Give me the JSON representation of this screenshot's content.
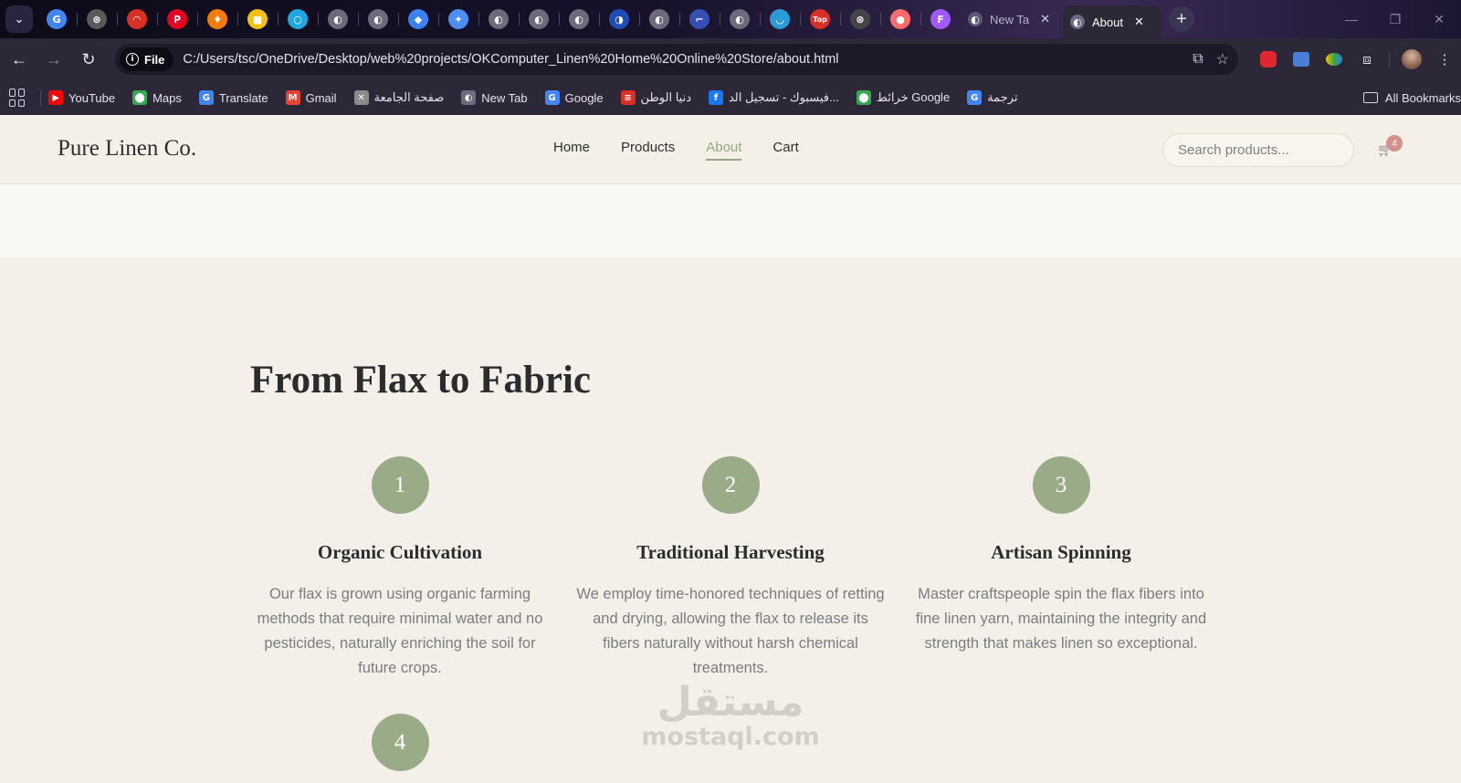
{
  "browser": {
    "pinned_tabs": [
      {
        "icon": "google-icon",
        "glyph": "G",
        "color": "#4285f4"
      },
      {
        "icon": "chatgpt-icon",
        "glyph": "⊛",
        "color": "#5a5a5a"
      },
      {
        "icon": "speed-icon",
        "glyph": "◠",
        "color": "#d93025"
      },
      {
        "icon": "pinterest-icon",
        "glyph": "P",
        "color": "#e60023"
      },
      {
        "icon": "flame-icon",
        "glyph": "♦",
        "color": "#f57c00"
      },
      {
        "icon": "folder-icon",
        "glyph": "■",
        "color": "#f4c20d"
      },
      {
        "icon": "circle-app-icon",
        "glyph": "○",
        "color": "#1ea7e1"
      },
      {
        "icon": "globe-icon",
        "glyph": "◐",
        "color": "#6b6b7b"
      },
      {
        "icon": "globe-icon",
        "glyph": "◐",
        "color": "#6b6b7b"
      },
      {
        "icon": "gem-icon",
        "glyph": "◆",
        "color": "#3b82f6"
      },
      {
        "icon": "gemini-icon",
        "glyph": "✦",
        "color": "#4c8df6"
      },
      {
        "icon": "globe-icon",
        "glyph": "◐",
        "color": "#6b6b7b"
      },
      {
        "icon": "globe-icon",
        "glyph": "◐",
        "color": "#6b6b7b"
      },
      {
        "icon": "globe-icon",
        "glyph": "◐",
        "color": "#6b6b7b"
      },
      {
        "icon": "moon-icon",
        "glyph": "◑",
        "color": "#1e4db7"
      },
      {
        "icon": "globe-icon",
        "glyph": "◐",
        "color": "#6b6b7b"
      },
      {
        "icon": "app-icon",
        "glyph": "⌐",
        "color": "#3451b2"
      },
      {
        "icon": "globe-icon",
        "glyph": "◐",
        "color": "#6b6b7b"
      },
      {
        "icon": "bowl-icon",
        "glyph": "◡",
        "color": "#2b9bd6"
      },
      {
        "icon": "top-icon",
        "glyph": "Top",
        "color": "#d93025"
      },
      {
        "icon": "openai-icon",
        "glyph": "⊛",
        "color": "#444444"
      },
      {
        "icon": "bubble-icon",
        "glyph": "●",
        "color": "#ff6b6b"
      },
      {
        "icon": "figma-icon",
        "glyph": "F",
        "color": "#a259ff"
      }
    ],
    "tabs": [
      {
        "title": "New Ta",
        "close": "✕"
      },
      {
        "title": "About",
        "close": "✕"
      }
    ],
    "new_tab": "+",
    "window_controls": {
      "minimize": "—",
      "maximize": "❐",
      "close": "✕"
    },
    "toolbar": {
      "back": "←",
      "forward": "→",
      "reload": "↻",
      "scheme_label": "File",
      "url": "C:/Users/tsc/OneDrive/Desktop/web%20projects/OKComputer_Linen%20Home%20Online%20Store/about.html",
      "translate_icon": "⧉",
      "star_icon": "☆",
      "menu_icon": "⋮"
    },
    "bookmarks": [
      {
        "label": "YouTube",
        "icon": "youtube-icon",
        "glyph": "▶",
        "color": "#ff0000"
      },
      {
        "label": "Maps",
        "icon": "maps-icon",
        "glyph": "⬤",
        "color": "#34a853"
      },
      {
        "label": "Translate",
        "icon": "translate-icon",
        "glyph": "G",
        "color": "#4285f4"
      },
      {
        "label": "Gmail",
        "icon": "gmail-icon",
        "glyph": "M",
        "color": "#ea4335"
      },
      {
        "label": "صفحة الجامعة",
        "icon": "university-icon",
        "glyph": "✕",
        "color": "#8a8a8a"
      },
      {
        "label": "New Tab",
        "icon": "globe-icon",
        "glyph": "◐",
        "color": "#6b6b7b"
      },
      {
        "label": "Google",
        "icon": "google-icon",
        "glyph": "G",
        "color": "#4285f4"
      },
      {
        "label": "دنيا الوطن",
        "icon": "news-icon",
        "glyph": "≡",
        "color": "#d93025"
      },
      {
        "label": "فيسبوك - تسجيل الد...",
        "icon": "facebook-icon",
        "glyph": "f",
        "color": "#1877f2"
      },
      {
        "label": "خرائط Google",
        "icon": "maps-icon",
        "glyph": "⬤",
        "color": "#34a853"
      },
      {
        "label": "ترجمة",
        "icon": "translate-icon",
        "glyph": "G",
        "color": "#4285f4"
      }
    ],
    "all_bookmarks": "All Bookmarks"
  },
  "site": {
    "logo": "Pure Linen Co.",
    "nav": [
      {
        "label": "Home",
        "active": false
      },
      {
        "label": "Products",
        "active": false
      },
      {
        "label": "About",
        "active": true
      },
      {
        "label": "Cart",
        "active": false
      }
    ],
    "search_placeholder": "Search products...",
    "cart_count": "4",
    "accent_color": "#94a684"
  },
  "process": {
    "title": "From Flax to Fabric",
    "steps": [
      {
        "number": "1",
        "title": "Organic Cultivation",
        "description": "Our flax is grown using organic farming methods that require minimal water and no pesticides, naturally enriching the soil for future crops."
      },
      {
        "number": "2",
        "title": "Traditional Harvesting",
        "description": "We employ time-honored techniques of retting and drying, allowing the flax to release its fibers naturally without harsh chemical treatments."
      },
      {
        "number": "3",
        "title": "Artisan Spinning",
        "description": "Master craftspeople spin the flax fibers into fine linen yarn, maintaining the integrity and strength that makes linen so exceptional."
      },
      {
        "number": "4",
        "title": "",
        "description": ""
      }
    ]
  },
  "watermark": {
    "logo_text": "مستقل",
    "domain": "mostaql.com"
  }
}
